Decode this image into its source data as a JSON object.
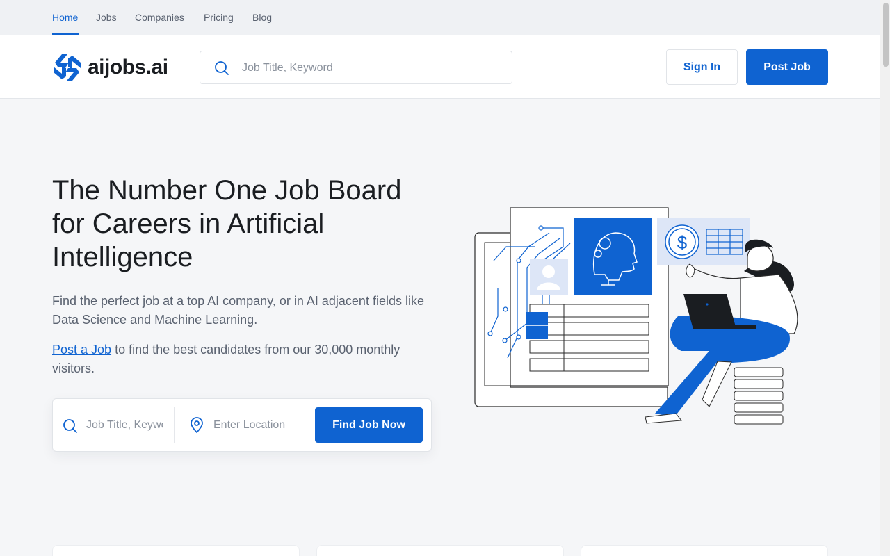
{
  "topnav": {
    "items": [
      {
        "label": "Home",
        "active": true
      },
      {
        "label": "Jobs"
      },
      {
        "label": "Companies"
      },
      {
        "label": "Pricing"
      },
      {
        "label": "Blog"
      }
    ]
  },
  "header": {
    "logo_text": "aijobs.ai",
    "search_placeholder": "Job Title, Keyword",
    "signin_label": "Sign In",
    "post_job_label": "Post Job"
  },
  "hero": {
    "title": "The Number One Job Board for Careers in Artificial Intelligence",
    "subtitle": "Find the perfect job at a top AI company, or in AI adjacent fields like Data Science and Machine Learning.",
    "post_link": "Post a Job",
    "post_text": " to find the best candidates from our 30,000 monthly visitors."
  },
  "finder": {
    "keyword_placeholder": "Job Title, Keyword",
    "location_placeholder": "Enter Location",
    "button_label": "Find Job Now"
  },
  "colors": {
    "accent": "#0f63d1",
    "page_bg": "#f5f6f8",
    "text_dark": "#1a1d21",
    "text_muted": "#5a6270"
  }
}
